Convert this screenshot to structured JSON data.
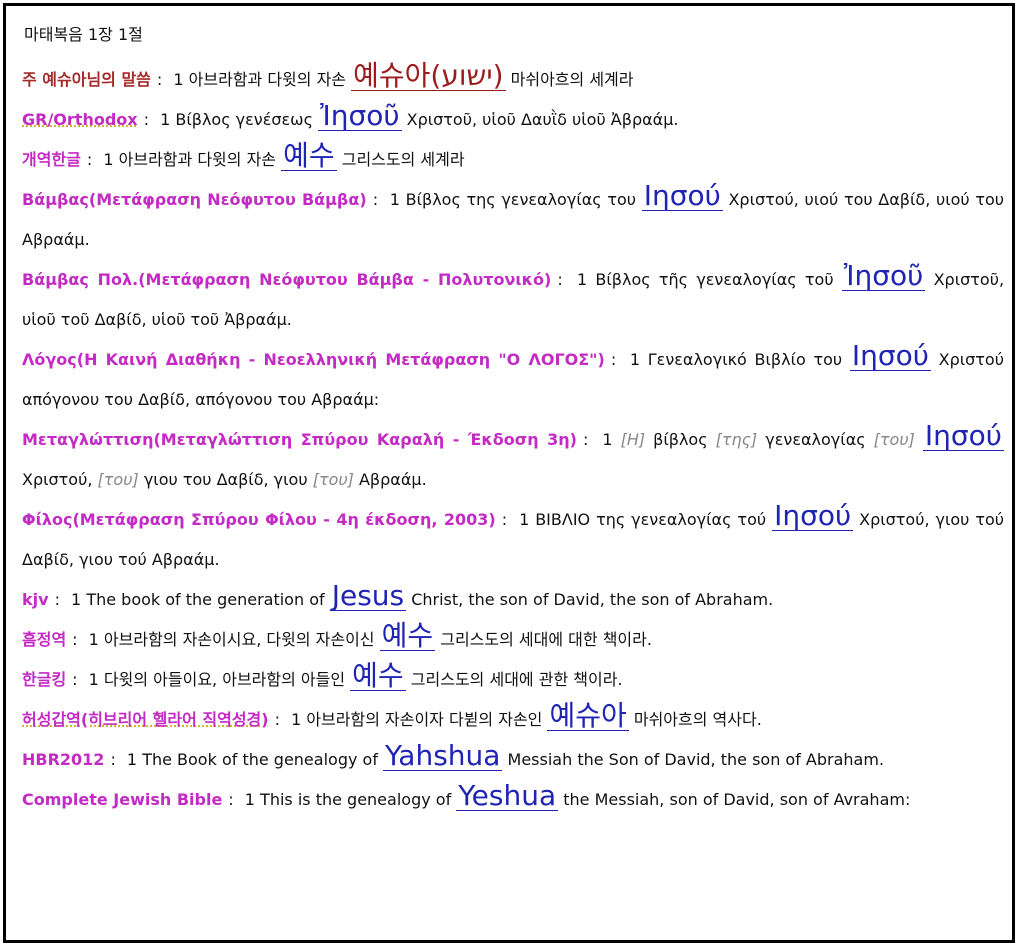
{
  "title": "마태복음 1장 1절",
  "verses": [
    {
      "source": "주 예슈아님의 말씀",
      "pre": "1 아브라함과 다윗의 자손",
      "name": "예슈아",
      "hebrew": "ישוע",
      "post": "마쉬아흐의 세계라"
    },
    {
      "source": "GR/Orthodox",
      "pre": "1 Βίβλος γενέσεως",
      "name": "Ἰησοῦ",
      "post": "Χριστοῦ, υἱοῦ Δαυῒδ υἱοῦ Ἀβραάμ."
    },
    {
      "source": "개역한글",
      "pre": "1 아브라함과 다윗의 자손",
      "name": "예수",
      "post": "그리스도의 세계라"
    },
    {
      "source": "Βάμβας(Μετάφραση Νεόφυτου Βάμβα)",
      "pre": "1 Βίβλος της γενεαλογίας του",
      "name": "Ιησού",
      "post": "Χριστού, υιού του Δαβίδ, υιού του Αβραάμ."
    },
    {
      "source": "Βάμβας Πολ.(Μετάφραση Νεόφυτου Βάμβα - Πολυτονικό)",
      "pre": "1 Βίβλος τῆς γενεαλογίας τοῦ",
      "name": "Ἰησοῦ",
      "post": "Χριστοῦ, υἱοῦ τοῦ Δαβίδ, υἱοῦ τοῦ Ἀβραάμ."
    },
    {
      "source": "Λόγος(Η Καινή Διαθήκη - Νεοελληνική Μετάφραση \"Ο ΛΟΓΟΣ\")",
      "pre": "1 Γενεαλογικό Βιβλίο του",
      "name": "Ιησού",
      "post": "Χριστού απόγονου του Δαβίδ, απόγονου του Αβραάμ:"
    },
    {
      "source": "Μεταγλώττιση(Μεταγλώττιση Σπύρου Καραλή - Έκδοση 3η)",
      "parts": {
        "n1": "1",
        "g1": "Η",
        "t1": "βίβλος",
        "g2": "της",
        "t2": "γενεαλογίας",
        "g3": "του",
        "name": "Ιησού",
        "t3": "Χριστού,",
        "g4": "του",
        "t4": "γιου του Δαβίδ, γιου",
        "g5": "του",
        "t5": "Αβραάμ."
      }
    },
    {
      "source": "Φίλος(Μετάφραση Σπύρου Φίλου - 4η έκδοση, 2003)",
      "pre": "1 ΒΙΒΛΙΟ της γενεαλογίας τού",
      "name": "Ιησού",
      "post": "Χριστού, γιου τού Δαβίδ, γιου τού Αβραάμ."
    },
    {
      "source": "kjv",
      "pre": "1 The book of the generation of",
      "name": "Jesus",
      "post": "Christ, the son of David, the son of Abraham."
    },
    {
      "source": "흠정역",
      "pre": "1 아브라함의 자손이시요, 다윗의 자손이신",
      "name": "예수",
      "post": "그리스도의 세대에 대한 책이라."
    },
    {
      "source": "한글킹",
      "pre": "1 다윗의 아들이요, 아브라함의 아들인",
      "name": "예수",
      "post": "그리스도의 세대에 관한 책이라."
    },
    {
      "source": "허성갑역(히브리어 헬라어 직역성경)",
      "pre": "1 아브라함의 자손이자 다뷛의 자손인",
      "name": "예슈아",
      "post": "마쉬아흐의 역사다."
    },
    {
      "source": "HBR2012",
      "pre": "1 The Book of the genealogy of",
      "name": "Yahshua",
      "post": "Messiah the Son of David, the son of Abraham."
    },
    {
      "source": "Complete Jewish Bible",
      "pre": "1 This is the genealogy of",
      "name": "Yeshua",
      "post": "the Messiah, son of David, son of Avraham:"
    }
  ]
}
